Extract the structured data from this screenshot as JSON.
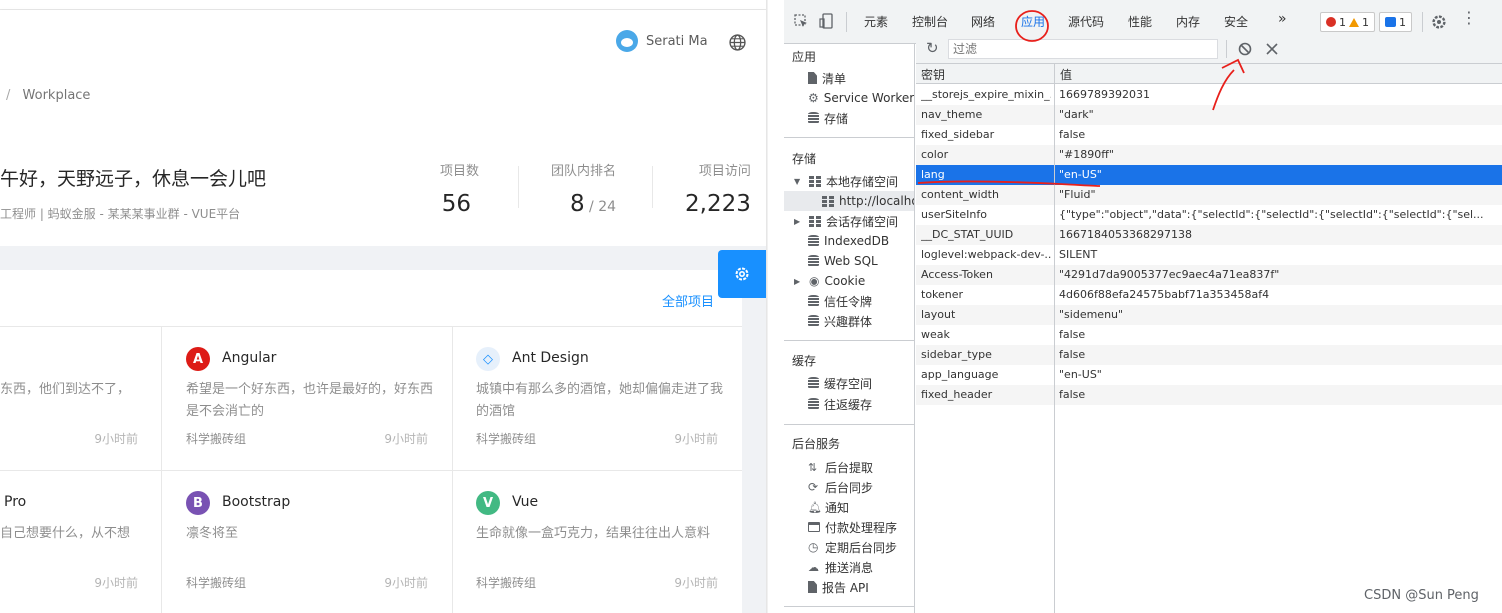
{
  "app": {
    "user_name": "Serati Ma",
    "breadcrumb_sep": "/",
    "breadcrumb": "Workplace",
    "welcome": "午好，天野远子，休息一会儿吧",
    "welcome_sub": "工程师 | 蚂蚁金服 - 某某某事业群 - VUE平台",
    "stats": [
      {
        "label": "项目数",
        "value": "56",
        "suffix": ""
      },
      {
        "label": "团队内排名",
        "value": "8",
        "suffix": " / 24"
      },
      {
        "label": "项目访问",
        "value": "2,223",
        "suffix": ""
      }
    ],
    "all_projects": "全部项目",
    "projects": [
      {
        "title": "",
        "desc": "东西，他们到达不了，",
        "group": "",
        "time": "9小时前"
      },
      {
        "title": "Angular",
        "icon": "A",
        "desc": "希望是一个好东西，也许是最好的，好东西是不会消亡的",
        "group": "科学搬砖组",
        "time": "9小时前"
      },
      {
        "title": "Ant Design",
        "icon": "◇",
        "desc": "城镇中有那么多的酒馆，她却偏偏走进了我的酒馆",
        "group": "科学搬砖组",
        "time": "9小时前"
      },
      {
        "title": "Pro",
        "desc": "自己想要什么，从不想",
        "group": "",
        "time": "9小时前"
      },
      {
        "title": "Bootstrap",
        "icon": "B",
        "desc": "凛冬将至",
        "group": "科学搬砖组",
        "time": "9小时前"
      },
      {
        "title": "Vue",
        "icon": "V",
        "desc": "生命就像一盒巧克力，结果往往出人意料",
        "group": "科学搬砖组",
        "time": "9小时前"
      }
    ],
    "colors": {
      "primary": "#1890ff",
      "angular": "#dd1b16",
      "bootstrap": "#7952b3",
      "vue": "#42b983"
    }
  },
  "devtools": {
    "tabs": [
      "元素",
      "控制台",
      "网络",
      "应用",
      "源代码",
      "性能",
      "内存",
      "安全",
      "»"
    ],
    "active_tab": "应用",
    "errors": "1",
    "warnings": "1",
    "messages": "1",
    "sidebar": {
      "app_section": "应用",
      "app_items": [
        "清单",
        "Service Workers",
        "存储"
      ],
      "storage_section": "存储",
      "local_storage": "本地存储空间",
      "local_origin": "http://localhost",
      "session_storage": "会话存储空间",
      "storage_items": [
        "IndexedDB",
        "Web SQL",
        "Cookie",
        "信任令牌",
        "兴趣群体"
      ],
      "cache_section": "缓存",
      "cache_items": [
        "缓存空间",
        "往返缓存"
      ],
      "bg_section": "后台服务",
      "bg_items": [
        "后台提取",
        "后台同步",
        "通知",
        "付款处理程序",
        "定期后台同步",
        "推送消息",
        "报告 API"
      ]
    },
    "filter_placeholder": "过滤",
    "columns": {
      "key": "密钥",
      "value": "值"
    },
    "rows": [
      {
        "k": "__storejs_expire_mixin_...",
        "v": "1669789392031"
      },
      {
        "k": "nav_theme",
        "v": "\"dark\""
      },
      {
        "k": "fixed_sidebar",
        "v": "false"
      },
      {
        "k": "color",
        "v": "\"#1890ff\""
      },
      {
        "k": "lang",
        "v": "\"en-US\""
      },
      {
        "k": "content_width",
        "v": "\"Fluid\""
      },
      {
        "k": "userSiteInfo",
        "v": "{\"type\":\"object\",\"data\":{\"selectId\":{\"selectId\":{\"selectId\":{\"selectId\":{\"sel..."
      },
      {
        "k": "__DC_STAT_UUID",
        "v": "1667184053368297138"
      },
      {
        "k": "loglevel:webpack-dev-...",
        "v": "SILENT"
      },
      {
        "k": "Access-Token",
        "v": "\"4291d7da9005377ec9aec4a71ea837f\""
      },
      {
        "k": "tokener",
        "v": "4d606f88efa24575babf71a353458af4"
      },
      {
        "k": "layout",
        "v": "\"sidemenu\""
      },
      {
        "k": "weak",
        "v": "false"
      },
      {
        "k": "sidebar_type",
        "v": "false"
      },
      {
        "k": "app_language",
        "v": "\"en-US\""
      },
      {
        "k": "fixed_header",
        "v": "false"
      }
    ],
    "selected_row": 4
  },
  "watermark": "CSDN @Sun   Peng"
}
